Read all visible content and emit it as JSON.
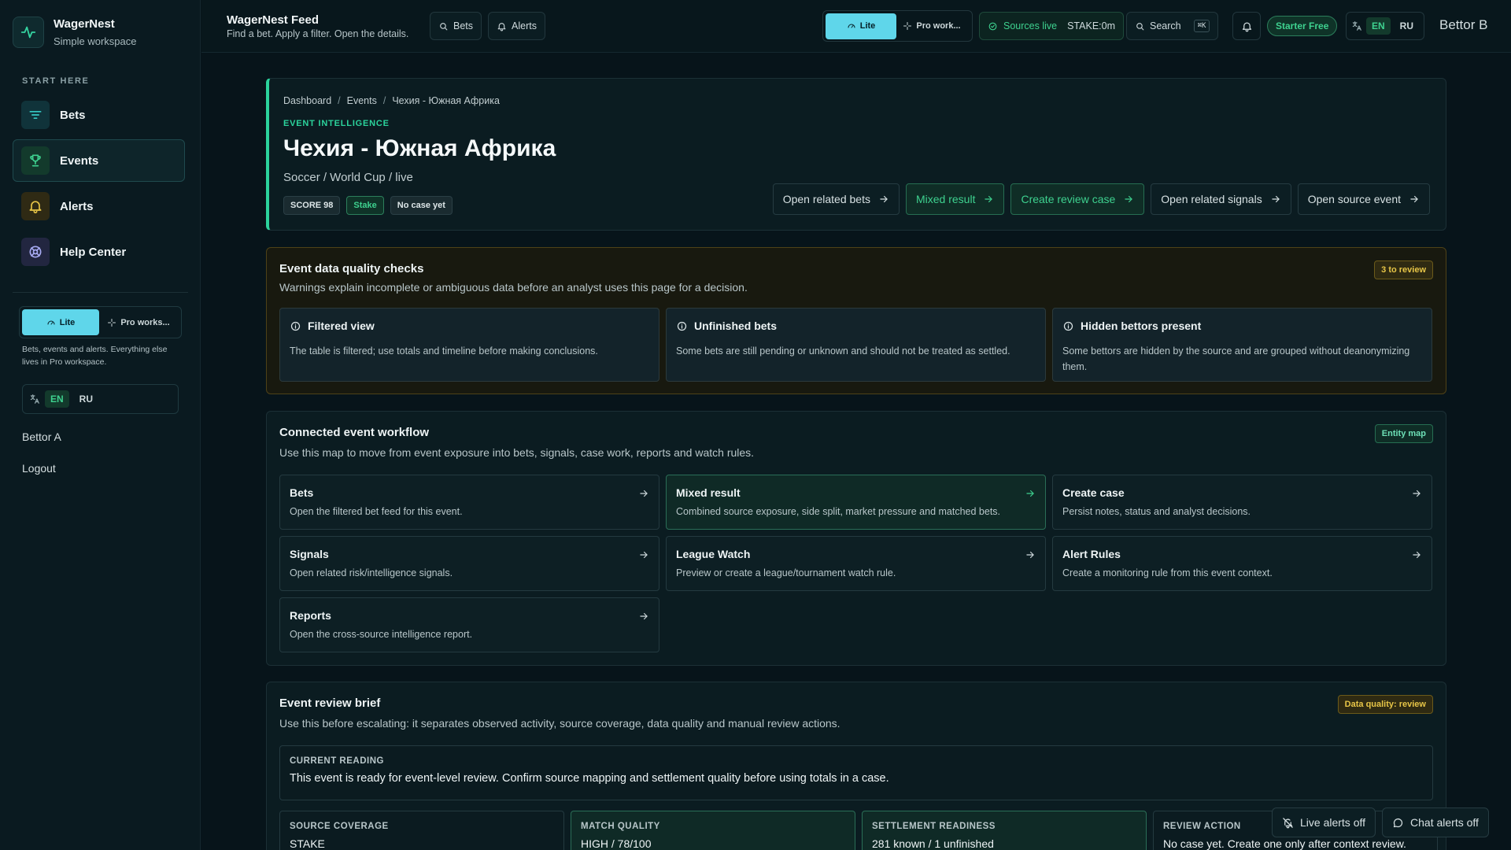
{
  "brand": {
    "name": "WagerNest",
    "subtitle": "Simple workspace"
  },
  "sidebar": {
    "section_label": "START HERE",
    "items": [
      {
        "label": "Bets",
        "icon": "filter-icon"
      },
      {
        "label": "Events",
        "icon": "trophy-icon",
        "active": true
      },
      {
        "label": "Alerts",
        "icon": "bell-icon"
      },
      {
        "label": "Help Center",
        "icon": "lifebuoy-icon"
      }
    ],
    "mode": {
      "lite": "Lite",
      "pro": "Pro works..."
    },
    "mode_note": "Bets, events and alerts. Everything else lives in Pro workspace.",
    "lang": {
      "en": "EN",
      "ru": "RU"
    },
    "user": "Bettor A",
    "logout": "Logout"
  },
  "topbar": {
    "title": "WagerNest Feed",
    "subtitle": "Find a bet. Apply a filter. Open the details.",
    "bets": "Bets",
    "alerts": "Alerts",
    "mode": {
      "lite": "Lite",
      "pro": "Pro work..."
    },
    "sources": "Sources live",
    "stake_status": "STAKE:0m",
    "search": "Search",
    "shortcut": "⌘K",
    "plan": "Starter Free",
    "lang": {
      "en": "EN",
      "ru": "RU"
    },
    "user": "Bettor B"
  },
  "hero": {
    "breadcrumbs": [
      "Dashboard",
      "Events",
      "Чехия - Южная Африка"
    ],
    "eyebrow": "EVENT INTELLIGENCE",
    "title": "Чехия - Южная Африка",
    "subtitle": "Soccer / World Cup / live",
    "tags": {
      "score": "SCORE 98",
      "source": "Stake",
      "case": "No case yet"
    },
    "actions": {
      "related_bets": "Open related bets",
      "mixed_result": "Mixed result",
      "create_case": "Create review case",
      "related_signals": "Open related signals",
      "source_event": "Open source event"
    }
  },
  "quality": {
    "title": "Event data quality checks",
    "subtitle": "Warnings explain incomplete or ambiguous data before an analyst uses this page for a decision.",
    "badge": "3 to review",
    "checks": [
      {
        "title": "Filtered view",
        "body": "The table is filtered; use totals and timeline before making conclusions."
      },
      {
        "title": "Unfinished bets",
        "body": "Some bets are still pending or unknown and should not be treated as settled."
      },
      {
        "title": "Hidden bettors present",
        "body": "Some bettors are hidden by the source and are grouped without deanonymizing them."
      }
    ]
  },
  "workflow": {
    "title": "Connected event workflow",
    "subtitle": "Use this map to move from event exposure into bets, signals, case work, reports and watch rules.",
    "badge": "Entity map",
    "cards": [
      {
        "title": "Bets",
        "desc": "Open the filtered bet feed for this event."
      },
      {
        "title": "Mixed result",
        "desc": "Combined source exposure, side split, market pressure and matched bets."
      },
      {
        "title": "Create case",
        "desc": "Persist notes, status and analyst decisions."
      },
      {
        "title": "Signals",
        "desc": "Open related risk/intelligence signals."
      },
      {
        "title": "League Watch",
        "desc": "Preview or create a league/tournament watch rule."
      },
      {
        "title": "Alert Rules",
        "desc": "Create a monitoring rule from this event context."
      },
      {
        "title": "Reports",
        "desc": "Open the cross-source intelligence report."
      }
    ]
  },
  "brief": {
    "title": "Event review brief",
    "subtitle": "Use this before escalating: it separates observed activity, source coverage, data quality and manual review actions.",
    "badge": "Data quality: review",
    "reading_label": "CURRENT READING",
    "reading_text": "This event is ready for event-level review. Confirm source mapping and settlement quality before using totals in a case.",
    "metrics": [
      {
        "label": "SOURCE COVERAGE",
        "value": "STAKE"
      },
      {
        "label": "MATCH QUALITY",
        "value": "HIGH / 78/100"
      },
      {
        "label": "SETTLEMENT READINESS",
        "value": "281 known / 1 unfinished"
      },
      {
        "label": "REVIEW ACTION",
        "value": "No case yet. Create one only after context review."
      }
    ]
  },
  "toasts": {
    "live": "Live alerts off",
    "chat": "Chat alerts off"
  }
}
